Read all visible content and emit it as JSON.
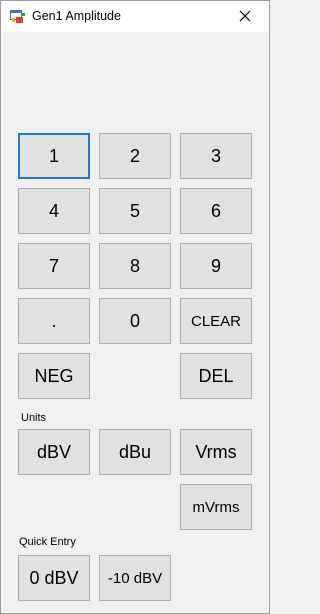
{
  "window": {
    "title": "Gen1 Amplitude",
    "app_icon": "form-window-icon",
    "close_icon": "close-icon"
  },
  "keypad": {
    "btn_1": "1",
    "btn_2": "2",
    "btn_3": "3",
    "btn_4": "4",
    "btn_5": "5",
    "btn_6": "6",
    "btn_7": "7",
    "btn_8": "8",
    "btn_9": "9",
    "btn_dot": ".",
    "btn_0": "0",
    "btn_clear": "CLEAR",
    "btn_neg": "NEG",
    "btn_del": "DEL"
  },
  "units": {
    "label": "Units",
    "dbv": "dBV",
    "dbu": "dBu",
    "vrms": "Vrms",
    "mvrms": "mVrms"
  },
  "quick_entry": {
    "label": "Quick Entry",
    "zero_dbv": "0 dBV",
    "minus10_dbv": "-10 dBV"
  }
}
